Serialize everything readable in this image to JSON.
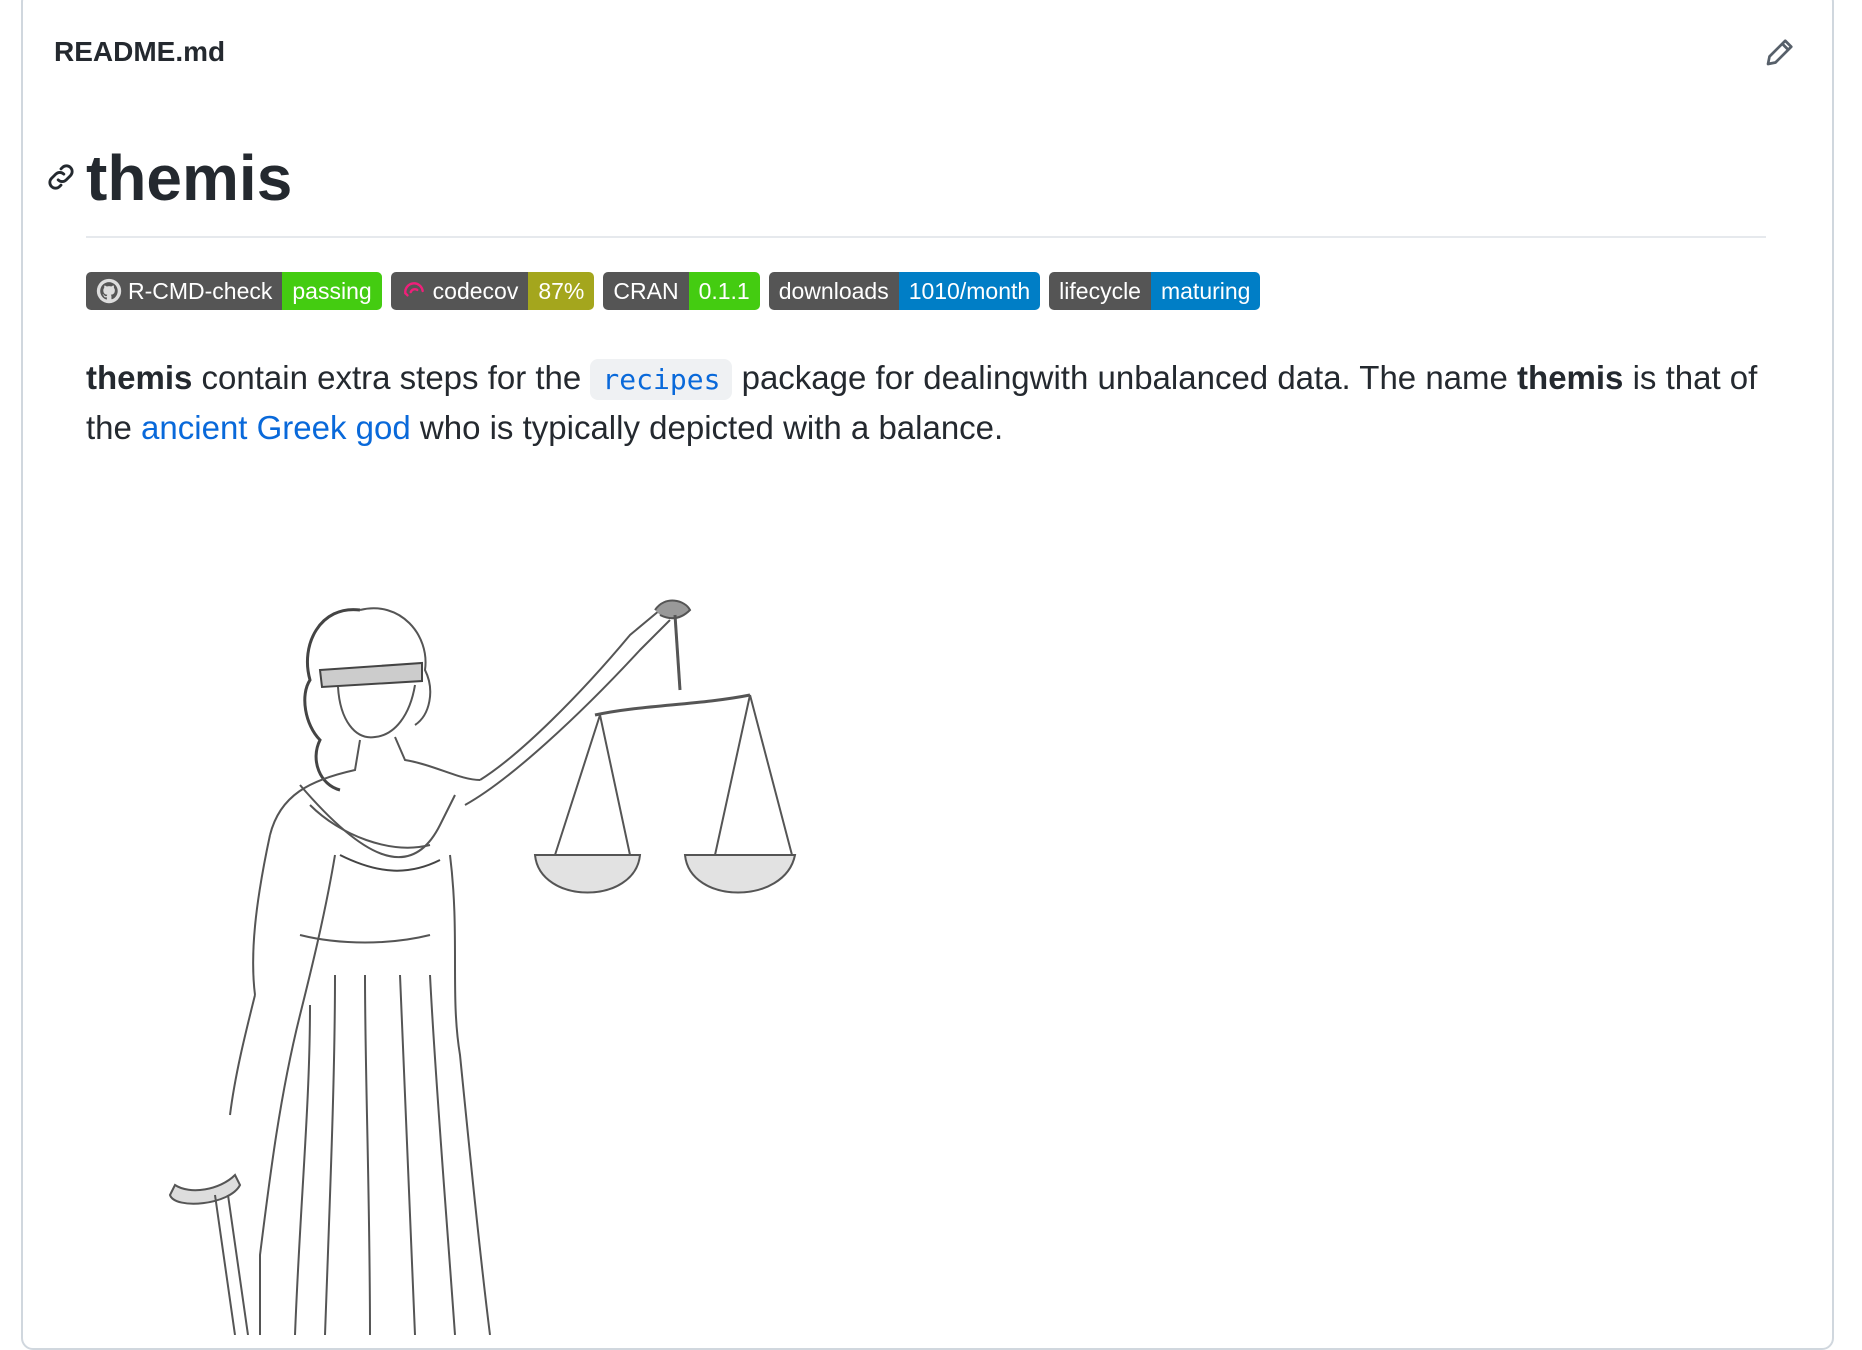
{
  "readme": {
    "filename": "README.md",
    "title": "themis",
    "badges": [
      {
        "label": "R-CMD-check",
        "value": "passing",
        "color": "#4c1"
      },
      {
        "label": "codecov",
        "value": "87%",
        "color": "#a4a61d"
      },
      {
        "label": "CRAN",
        "value": "0.1.1",
        "color": "#4c1"
      },
      {
        "label": "downloads",
        "value": "1010/month",
        "color": "#007ec6"
      },
      {
        "label": "lifecycle",
        "value": "maturing",
        "color": "#007ec6"
      }
    ],
    "para": {
      "t1": "themis",
      "t2": " contain extra steps for the ",
      "code": "recipes",
      "t3": " package for dealingwith unbalanced data. The name ",
      "t4": "themis",
      "t5": " is that of the ",
      "link": "ancient Greek god",
      "t6": " who is typically depicted with a balance."
    }
  },
  "icons": {
    "edit": "pencil-icon",
    "anchor": "link-icon",
    "github": "github-icon",
    "codecov": "codecov-icon"
  }
}
